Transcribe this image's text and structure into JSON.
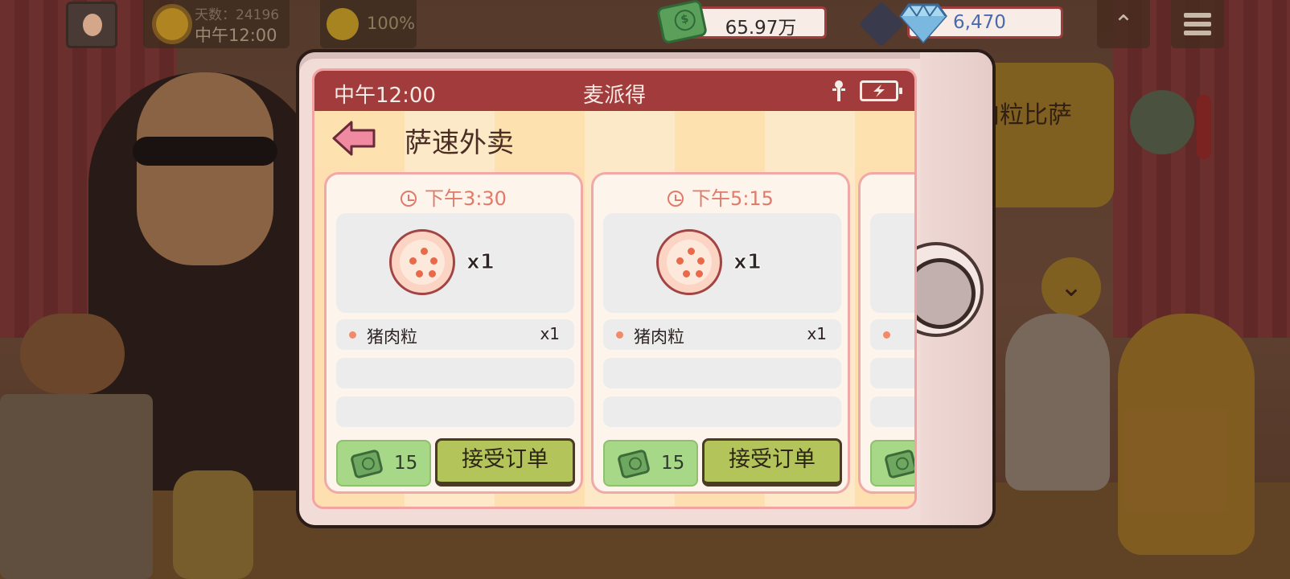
{
  "hud": {
    "day_label": "天数：24196",
    "time": "中午12:00",
    "mood": "100%",
    "money": "65.97万",
    "gems": "6,470"
  },
  "background": {
    "shop_sign": "肉粒比萨"
  },
  "phone": {
    "status_time": "中午12:00",
    "status_title": "麦派得",
    "app_title": "萨速外卖",
    "orders": [
      {
        "time": "下午3:30",
        "pizza_qty": "x1",
        "ingredients": [
          {
            "name": "猪肉粒",
            "qty": "x1"
          }
        ],
        "reward": "15",
        "accept_label": "接受订单"
      },
      {
        "time": "下午5:15",
        "pizza_qty": "x1",
        "ingredients": [
          {
            "name": "猪肉粒",
            "qty": "x1"
          }
        ],
        "reward": "15",
        "accept_label": "接受订单"
      }
    ]
  },
  "colors": {
    "status_bar": "#a23b3b",
    "accept_button": "#b2c45a",
    "reward_bg": "#a6d888",
    "order_time": "#e07a6a",
    "gem_value": "#4a6aae"
  }
}
